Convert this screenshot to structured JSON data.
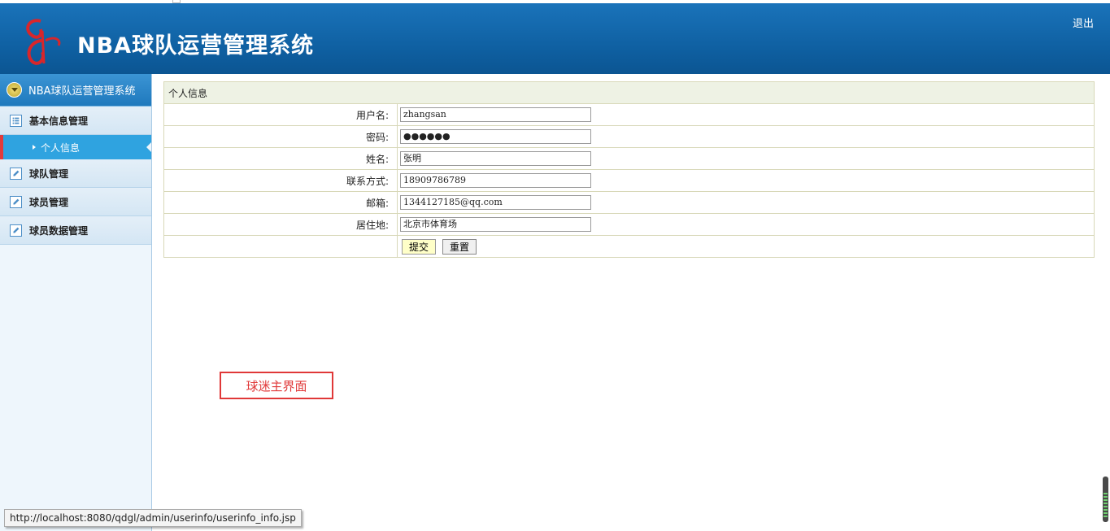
{
  "header": {
    "title": "NBA球队运营管理系统",
    "logout": "退出"
  },
  "sidebar": {
    "title": "NBA球队运营管理系统",
    "items": [
      {
        "label": "基本信息管理"
      },
      {
        "label": "个人信息"
      },
      {
        "label": "球队管理"
      },
      {
        "label": "球员管理"
      },
      {
        "label": "球员数据管理"
      }
    ]
  },
  "form": {
    "caption": "个人信息",
    "fields": [
      {
        "label": "用户名:",
        "value": "zhangsan"
      },
      {
        "label": "密码:",
        "value": "●●●●●●"
      },
      {
        "label": "姓名:",
        "value": "张明"
      },
      {
        "label": "联系方式:",
        "value": "18909786789"
      },
      {
        "label": "邮箱:",
        "value": "1344127185@qq.com"
      },
      {
        "label": "居住地:",
        "value": "北京市体育场"
      }
    ],
    "submit": "提交",
    "reset": "重置"
  },
  "annotation": "球迷主界面",
  "status_url": "http://localhost:8080/qdgl/admin/userinfo/userinfo_info.jsp",
  "colors": {
    "header_bg": "#0e5e9f",
    "accent": "#2fa3e0",
    "annotation": "#e03838"
  }
}
